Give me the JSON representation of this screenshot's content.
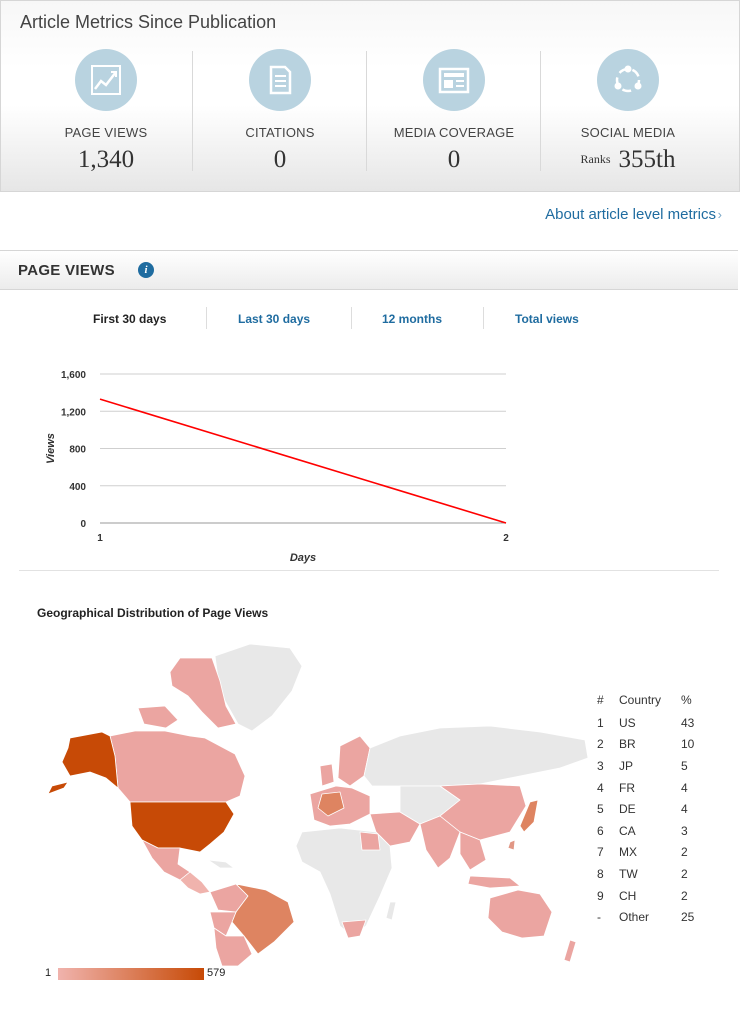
{
  "header": {
    "title": "Article Metrics Since Publication",
    "metrics": [
      {
        "label": "PAGE VIEWS",
        "value": "1,340",
        "icon": "line-chart-icon"
      },
      {
        "label": "CITATIONS",
        "value": "0",
        "icon": "document-icon"
      },
      {
        "label": "MEDIA COVERAGE",
        "value": "0",
        "icon": "newspaper-icon"
      },
      {
        "label": "SOCIAL MEDIA",
        "prefix": "Ranks",
        "value": "355th",
        "icon": "share-icon"
      }
    ],
    "about_link": "About article level metrics",
    "about_arrow": "›"
  },
  "page_views": {
    "title": "PAGE VIEWS",
    "info_icon": "i",
    "tabs": [
      "First 30 days",
      "Last 30 days",
      "12 months",
      "Total views"
    ],
    "active_tab": "First 30 days"
  },
  "colors": {
    "accent_link": "#1f6ca0",
    "line": "#ff0000",
    "map_max": "#c74a06",
    "map_min": "#f0b3ad",
    "map_none": "#e8e8e8",
    "icon_circle": "#b9d3e0"
  },
  "chart_data": [
    {
      "type": "line",
      "xlabel": "Days",
      "ylabel": "Views",
      "x": [
        1,
        2
      ],
      "x_ticks": [
        "1",
        "2"
      ],
      "series": [
        {
          "values": [
            1330,
            0
          ]
        }
      ],
      "ylim": [
        0,
        1600
      ],
      "y_ticks": [
        "0",
        "400",
        "800",
        "1,200",
        "1,600"
      ],
      "grid": true
    }
  ],
  "geo": {
    "title": "Geographical Distribution of Page Views",
    "colorbar": {
      "min": "1",
      "max": "579"
    },
    "table": {
      "headers": [
        "#",
        "Country",
        "%"
      ],
      "rows": [
        [
          "1",
          "US",
          "43"
        ],
        [
          "2",
          "BR",
          "10"
        ],
        [
          "3",
          "JP",
          "5"
        ],
        [
          "4",
          "FR",
          "4"
        ],
        [
          "5",
          "DE",
          "4"
        ],
        [
          "6",
          "CA",
          "3"
        ],
        [
          "7",
          "MX",
          "2"
        ],
        [
          "8",
          "TW",
          "2"
        ],
        [
          "9",
          "CH",
          "2"
        ],
        [
          "-",
          "Other",
          "25"
        ]
      ]
    }
  }
}
